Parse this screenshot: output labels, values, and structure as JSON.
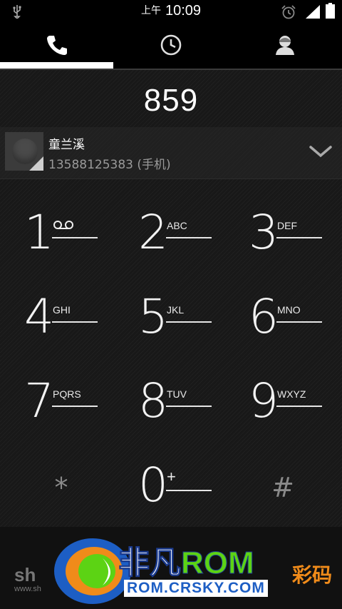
{
  "status_bar": {
    "ampm": "上午",
    "time": "10:09",
    "icons": [
      "usb-icon",
      "alarm-icon",
      "signal-icon",
      "battery-icon"
    ]
  },
  "tabs": [
    {
      "name": "phone",
      "icon": "phone-icon",
      "selected": true
    },
    {
      "name": "call-log",
      "icon": "clock-icon",
      "selected": false
    },
    {
      "name": "contacts",
      "icon": "person-icon",
      "selected": false
    }
  ],
  "dialer": {
    "digits": "859"
  },
  "suggestion": {
    "name": "童兰溪",
    "number": "13588125383 (手机)"
  },
  "keypad": [
    {
      "num": "1",
      "letters": "",
      "voicemail": true
    },
    {
      "num": "2",
      "letters": "ABC"
    },
    {
      "num": "3",
      "letters": "DEF"
    },
    {
      "num": "4",
      "letters": "GHI"
    },
    {
      "num": "5",
      "letters": "JKL"
    },
    {
      "num": "6",
      "letters": "MNO"
    },
    {
      "num": "7",
      "letters": "PQRS"
    },
    {
      "num": "8",
      "letters": "TUV"
    },
    {
      "num": "9",
      "letters": "WXYZ"
    },
    {
      "num": "*",
      "letters": ""
    },
    {
      "num": "0",
      "letters": "+"
    },
    {
      "num": "#",
      "letters": ""
    }
  ],
  "watermark": {
    "left_text": "sh",
    "left_sub": "www.sh",
    "logo_main_1": "非凡",
    "logo_main_2": "ROM",
    "logo_sub": "ROM.CRSKY.COM",
    "logo_right": "彩码"
  },
  "colors": {
    "accent": "#ffffff",
    "background": "#181818",
    "logo_green": "#5cd314",
    "logo_blue": "#1d5ec4"
  }
}
